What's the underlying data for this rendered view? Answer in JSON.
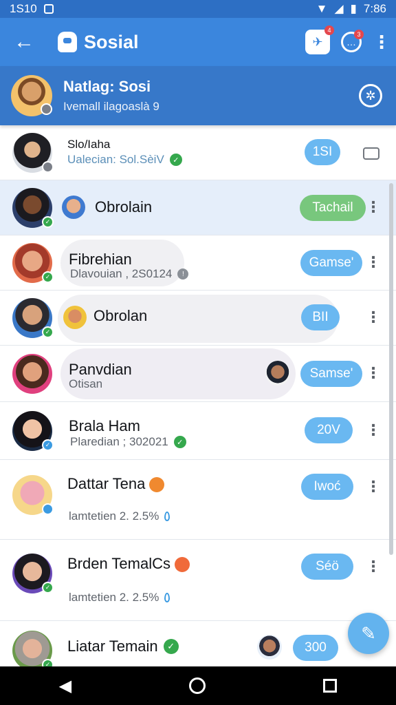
{
  "status": {
    "time_left": "1S10",
    "time_right": "7:86"
  },
  "app": {
    "title": "Sosial",
    "notif_count": "4",
    "chat_count": "3"
  },
  "profile": {
    "name": "Natlag: Sosi",
    "subtitle": "Ivemall ilagoaslà 9"
  },
  "rows": [
    {
      "name": "Slo/Iaha",
      "sub": "Ualecian: Sol.SèiV",
      "pill": "1SI",
      "action": "car-icon"
    },
    {
      "name": "Obrolain",
      "sub": "",
      "pill": "Tachail",
      "pill_color": "green",
      "highlight": true
    },
    {
      "name": "Fibrehian",
      "sub": "Dlavouian , 2S0124",
      "pill": "Gamse'"
    },
    {
      "name": "Obrolan",
      "sub": "",
      "pill": "BII"
    },
    {
      "name": "Panvdian",
      "sub": "Otisan",
      "pill": "Samse'"
    },
    {
      "name": "Brala Ham",
      "sub": "Plaredian ; 302021",
      "pill": "20V"
    },
    {
      "name": "Dattar Tena",
      "sub": "lamtetien 2. 2.5%",
      "pill": "Iwoć"
    },
    {
      "name": "Brden TemalCs",
      "sub": "lamtetien 2. 2.5%",
      "pill": "Séö"
    },
    {
      "name": "Liatar Temain",
      "sub": "",
      "pill": "300"
    }
  ],
  "colors": {
    "primary": "#3b86dd",
    "status_bar": "#2d6fc4",
    "pill": "#6ab8f1",
    "pill_green": "#78c77d",
    "verified": "#35a84d"
  }
}
